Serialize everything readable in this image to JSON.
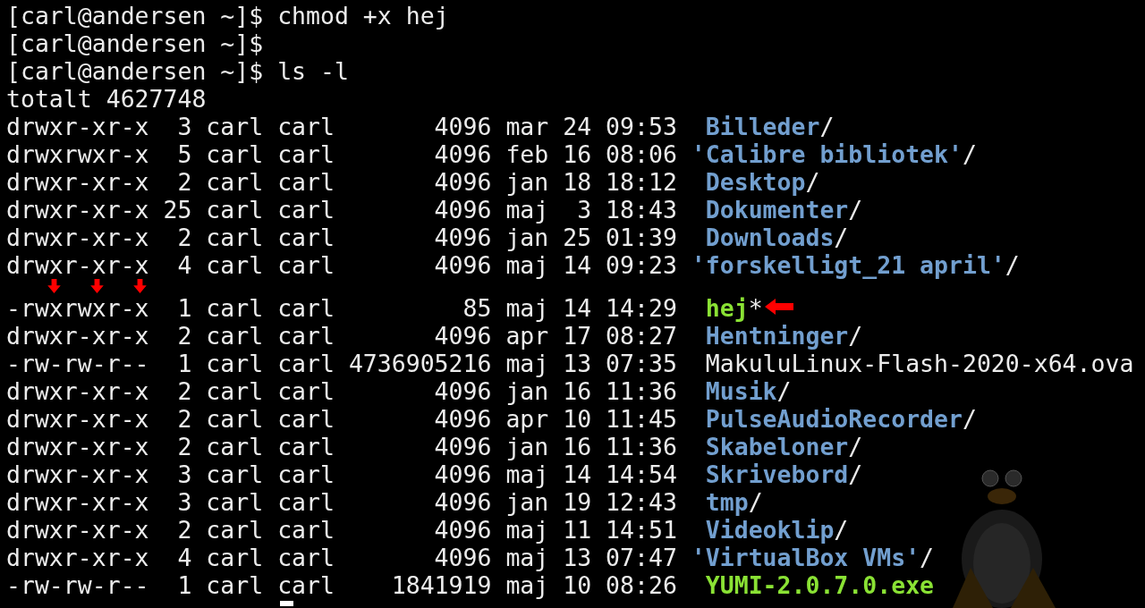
{
  "prompts": [
    {
      "prompt": "[carl@andersen ~]$",
      "command": "chmod +x hej"
    },
    {
      "prompt": "[carl@andersen ~]$"
    },
    {
      "prompt": "[carl@andersen ~]$",
      "command": "ls -l"
    }
  ],
  "total": "totalt 4627748",
  "listing": [
    {
      "perms": "drwxr-xr-x",
      "links": "3",
      "owner": "carl",
      "group": "carl",
      "size": "4096",
      "month": "mar",
      "day": "24",
      "time": "09:53",
      "name": "Billeder",
      "suffix": "/",
      "kind": "dir",
      "annotated": false
    },
    {
      "perms": "drwxrwxr-x",
      "links": "5",
      "owner": "carl",
      "group": "carl",
      "size": "4096",
      "month": "feb",
      "day": "16",
      "time": "08:06",
      "name": "'Calibre bibliotek'",
      "suffix": "/",
      "kind": "dir",
      "quoted": true,
      "annotated": false
    },
    {
      "perms": "drwxr-xr-x",
      "links": "2",
      "owner": "carl",
      "group": "carl",
      "size": "4096",
      "month": "jan",
      "day": "18",
      "time": "18:12",
      "name": "Desktop",
      "suffix": "/",
      "kind": "dir",
      "annotated": false
    },
    {
      "perms": "drwxr-xr-x",
      "links": "25",
      "owner": "carl",
      "group": "carl",
      "size": "4096",
      "month": "maj",
      "day": "3",
      "time": "18:43",
      "name": "Dokumenter",
      "suffix": "/",
      "kind": "dir",
      "annotated": false
    },
    {
      "perms": "drwxr-xr-x",
      "links": "2",
      "owner": "carl",
      "group": "carl",
      "size": "4096",
      "month": "jan",
      "day": "25",
      "time": "01:39",
      "name": "Downloads",
      "suffix": "/",
      "kind": "dir",
      "annotated": false
    },
    {
      "perms": "drwxr-xr-x",
      "links": "4",
      "owner": "carl",
      "group": "carl",
      "size": "4096",
      "month": "maj",
      "day": "14",
      "time": "09:23",
      "name": "'forskelligt_21 april'",
      "suffix": "/",
      "kind": "dir",
      "quoted": true,
      "annotated": false
    },
    {
      "perms": "-rwxrwxr-x",
      "links": "1",
      "owner": "carl",
      "group": "carl",
      "size": "85",
      "month": "maj",
      "day": "14",
      "time": "14:29",
      "name": "hej",
      "suffix": "*",
      "kind": "exec",
      "annotated": true
    },
    {
      "perms": "drwxr-xr-x",
      "links": "2",
      "owner": "carl",
      "group": "carl",
      "size": "4096",
      "month": "apr",
      "day": "17",
      "time": "08:27",
      "name": "Hentninger",
      "suffix": "/",
      "kind": "dir",
      "annotated": false
    },
    {
      "perms": "-rw-rw-r--",
      "links": "1",
      "owner": "carl",
      "group": "carl",
      "size": "4736905216",
      "month": "maj",
      "day": "13",
      "time": "07:35",
      "name": "MakuluLinux-Flash-2020-x64.ova",
      "kind": "file",
      "annotated": false
    },
    {
      "perms": "drwxr-xr-x",
      "links": "2",
      "owner": "carl",
      "group": "carl",
      "size": "4096",
      "month": "jan",
      "day": "16",
      "time": "11:36",
      "name": "Musik",
      "suffix": "/",
      "kind": "dir",
      "annotated": false
    },
    {
      "perms": "drwxr-xr-x",
      "links": "2",
      "owner": "carl",
      "group": "carl",
      "size": "4096",
      "month": "apr",
      "day": "10",
      "time": "11:45",
      "name": "PulseAudioRecorder",
      "suffix": "/",
      "kind": "dir",
      "annotated": false
    },
    {
      "perms": "drwxr-xr-x",
      "links": "2",
      "owner": "carl",
      "group": "carl",
      "size": "4096",
      "month": "jan",
      "day": "16",
      "time": "11:36",
      "name": "Skabeloner",
      "suffix": "/",
      "kind": "dir",
      "annotated": false
    },
    {
      "perms": "drwxr-xr-x",
      "links": "3",
      "owner": "carl",
      "group": "carl",
      "size": "4096",
      "month": "maj",
      "day": "14",
      "time": "14:54",
      "name": "Skrivebord",
      "suffix": "/",
      "kind": "dir",
      "annotated": false
    },
    {
      "perms": "drwxr-xr-x",
      "links": "3",
      "owner": "carl",
      "group": "carl",
      "size": "4096",
      "month": "jan",
      "day": "19",
      "time": "12:43",
      "name": "tmp",
      "suffix": "/",
      "kind": "dir",
      "annotated": false
    },
    {
      "perms": "drwxr-xr-x",
      "links": "2",
      "owner": "carl",
      "group": "carl",
      "size": "4096",
      "month": "maj",
      "day": "11",
      "time": "14:51",
      "name": "Videoklip",
      "suffix": "/",
      "kind": "dir",
      "annotated": false
    },
    {
      "perms": "drwxr-xr-x",
      "links": "4",
      "owner": "carl",
      "group": "carl",
      "size": "4096",
      "month": "maj",
      "day": "13",
      "time": "07:47",
      "name": "'VirtualBox VMs'",
      "suffix": "/",
      "kind": "dir",
      "quoted": true,
      "annotated": false
    },
    {
      "perms": "-rw-rw-r--",
      "links": "1",
      "owner": "carl",
      "group": "carl",
      "size": "1841919",
      "month": "maj",
      "day": "10",
      "time": "08:26",
      "name": "YUMI-2.0.7.0.exe",
      "kind": "exec",
      "annotated": false
    }
  ]
}
